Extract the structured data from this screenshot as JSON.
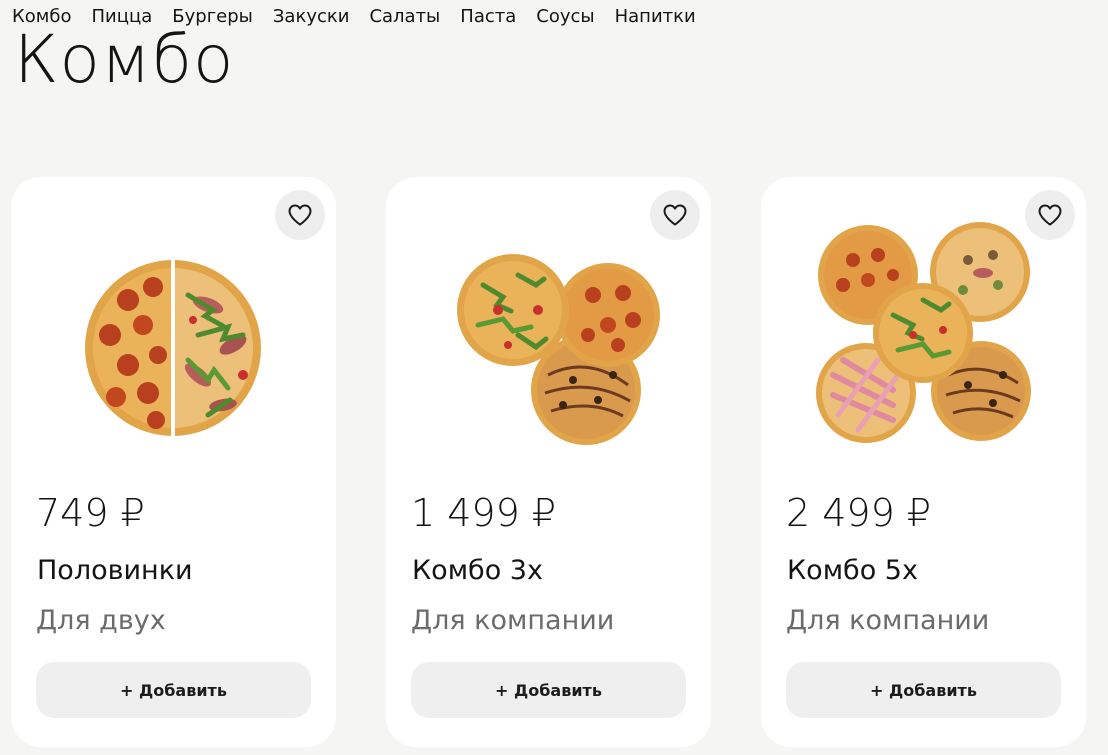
{
  "nav": {
    "items": [
      "Комбо",
      "Пицца",
      "Бургеры",
      "Закуски",
      "Салаты",
      "Паста",
      "Соусы",
      "Напитки"
    ]
  },
  "page_title": "Комбо",
  "products": [
    {
      "price": "749 ₽",
      "name": "Половинки",
      "description": "Для двух",
      "add_label": "+ Добавить",
      "image_icon": "pizza-halves-image"
    },
    {
      "price": "1 499 ₽",
      "name": "Комбо 3х",
      "description": "Для компании",
      "add_label": "+ Добавить",
      "image_icon": "pizza-combo-3-image"
    },
    {
      "price": "2 499 ₽",
      "name": "Комбо 5х",
      "description": "Для компании",
      "add_label": "+ Добавить",
      "image_icon": "pizza-combo-5-image"
    }
  ],
  "icons": {
    "favorite": "heart-icon"
  },
  "colors": {
    "background": "#f5f5f3",
    "card": "#ffffff",
    "button": "#efefef",
    "muted_text": "#6b6b6b",
    "crust": "#e2a448",
    "pepperoni": "#b8401f",
    "greens": "#4f8a2e"
  }
}
